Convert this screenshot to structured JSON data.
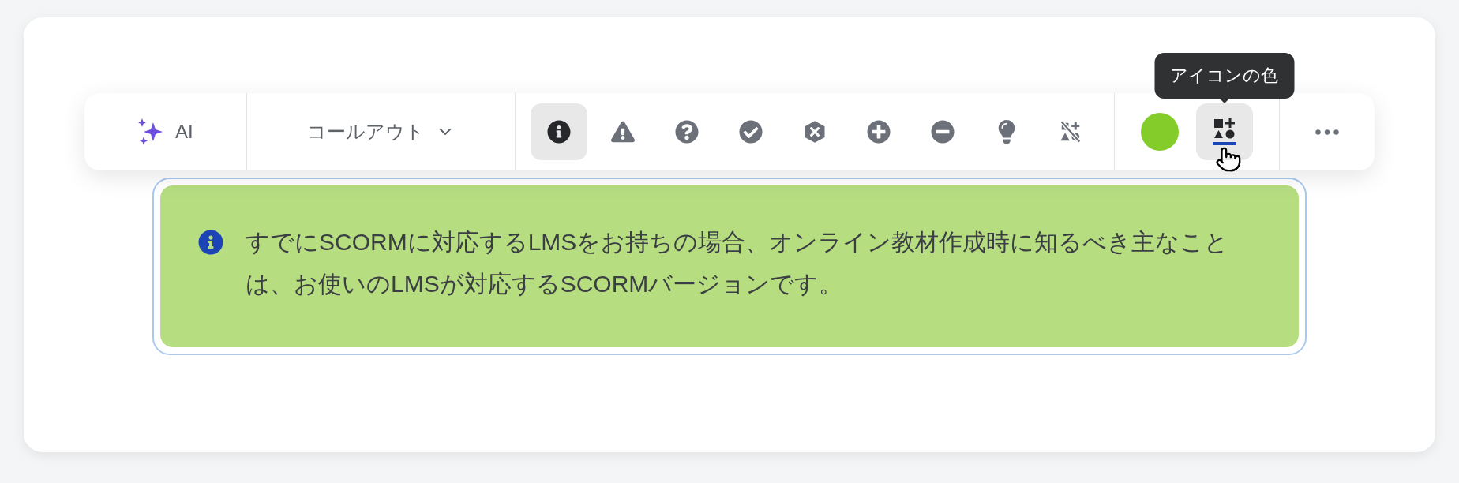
{
  "toolbar": {
    "ai_button": {
      "label": "AI"
    },
    "style_dropdown": {
      "label": "コールアウト"
    },
    "icons": [
      {
        "kind": "info",
        "selected": true
      },
      {
        "kind": "warning",
        "selected": false
      },
      {
        "kind": "question",
        "selected": false
      },
      {
        "kind": "check",
        "selected": false
      },
      {
        "kind": "error",
        "selected": false
      },
      {
        "kind": "plus",
        "selected": false
      },
      {
        "kind": "minus",
        "selected": false
      },
      {
        "kind": "lightbulb",
        "selected": false
      },
      {
        "kind": "none",
        "selected": false
      }
    ],
    "color_swatch": {
      "color": "#84cc2a"
    },
    "icon_color_button": {
      "hovered": true,
      "tooltip": "アイコンの色"
    }
  },
  "callout": {
    "text": "すでにSCORMに対応するLMSをお持ちの場合、オンライン教材作成時に知るべき主なことは、お使いのLMSが対応するSCORMバージョンです。"
  }
}
